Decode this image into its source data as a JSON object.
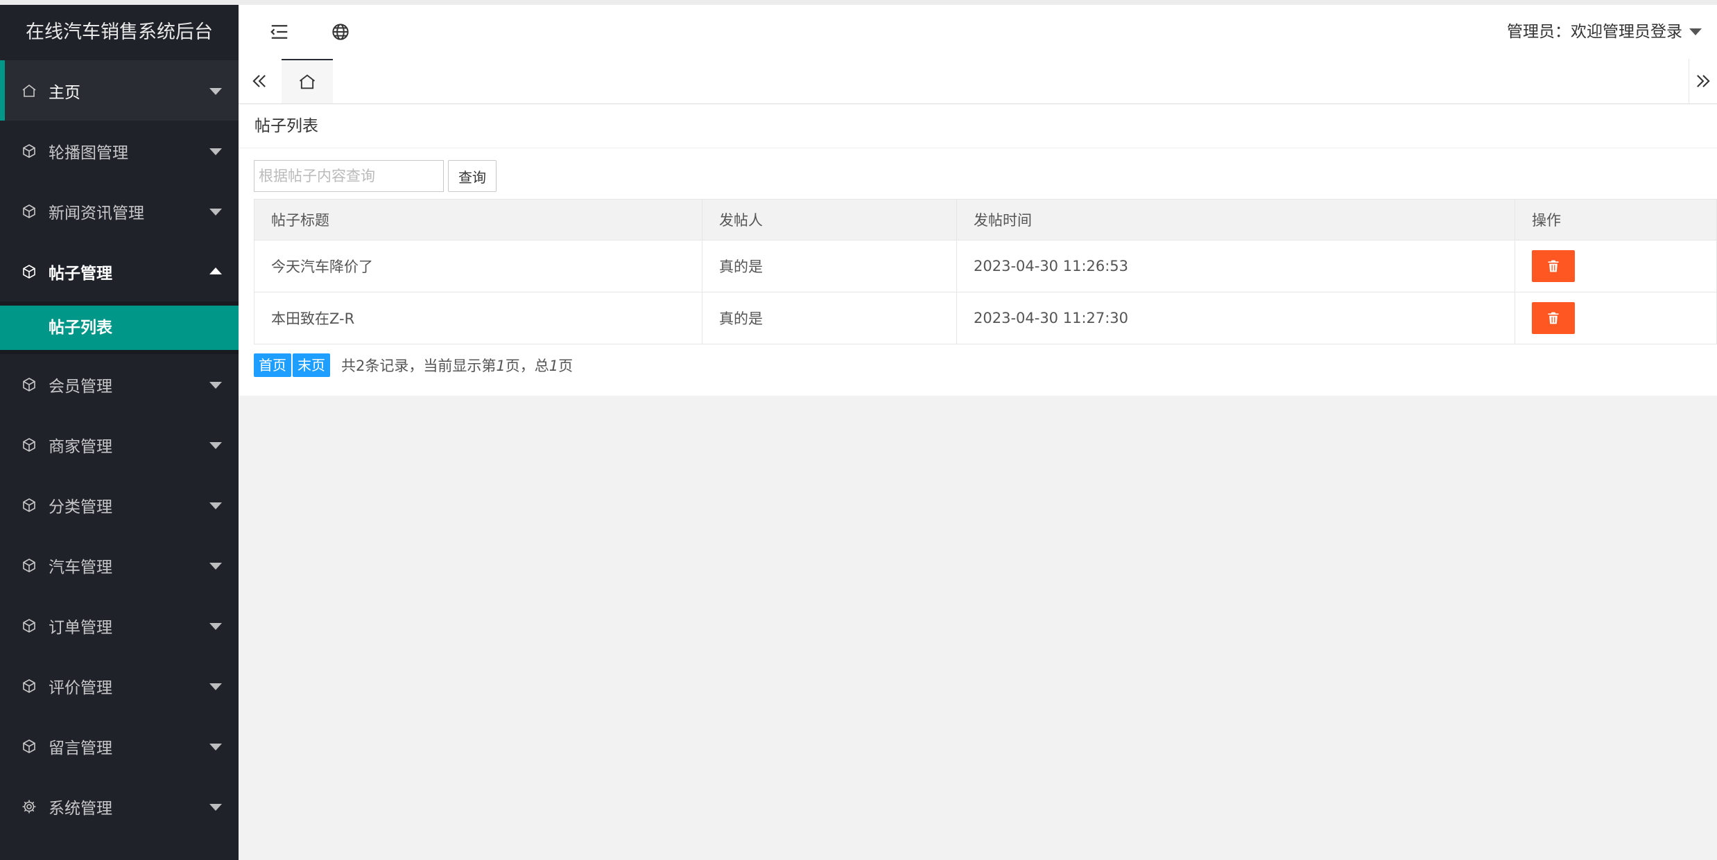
{
  "app": {
    "title": "在线汽车销售系统后台"
  },
  "sidebar": {
    "items": [
      {
        "label": "主页",
        "icon": "home-icon"
      },
      {
        "label": "轮播图管理",
        "icon": "cube-icon"
      },
      {
        "label": "新闻资讯管理",
        "icon": "cube-icon"
      },
      {
        "label": "帖子管理",
        "icon": "cube-icon",
        "expanded": true,
        "children": [
          {
            "label": "帖子列表"
          }
        ]
      },
      {
        "label": "会员管理",
        "icon": "cube-icon"
      },
      {
        "label": "商家管理",
        "icon": "cube-icon"
      },
      {
        "label": "分类管理",
        "icon": "cube-icon"
      },
      {
        "label": "汽车管理",
        "icon": "cube-icon"
      },
      {
        "label": "订单管理",
        "icon": "cube-icon"
      },
      {
        "label": "评价管理",
        "icon": "cube-icon"
      },
      {
        "label": "留言管理",
        "icon": "cube-icon"
      },
      {
        "label": "系统管理",
        "icon": "gear-icon"
      }
    ]
  },
  "header": {
    "user_label": "管理员：欢迎管理员登录",
    "icons": [
      "menu-collapse-icon",
      "globe-icon"
    ]
  },
  "tabs": {
    "home_icon": "home-icon"
  },
  "main": {
    "title": "帖子列表",
    "search": {
      "placeholder": "根据帖子内容查询",
      "value": "",
      "button": "查询"
    },
    "table": {
      "headers": [
        "帖子标题",
        "发帖人",
        "发帖时间",
        "操作"
      ],
      "rows": [
        {
          "title": "今天汽车降价了",
          "author": "真的是",
          "time": "2023-04-30 11:26:53"
        },
        {
          "title": "本田致在Z-R",
          "author": "真的是",
          "time": "2023-04-30 11:27:30"
        }
      ]
    },
    "pager": {
      "first": "首页",
      "last": "末页",
      "info_prefix": "共2条记录，当前显示第",
      "current": "1",
      "info_mid": "页，总",
      "total": "1",
      "info_suffix": "页"
    }
  },
  "colors": {
    "accent": "#009688",
    "danger": "#ff5722",
    "primary": "#1e9fff",
    "sidebar_bg": "#20222a"
  }
}
